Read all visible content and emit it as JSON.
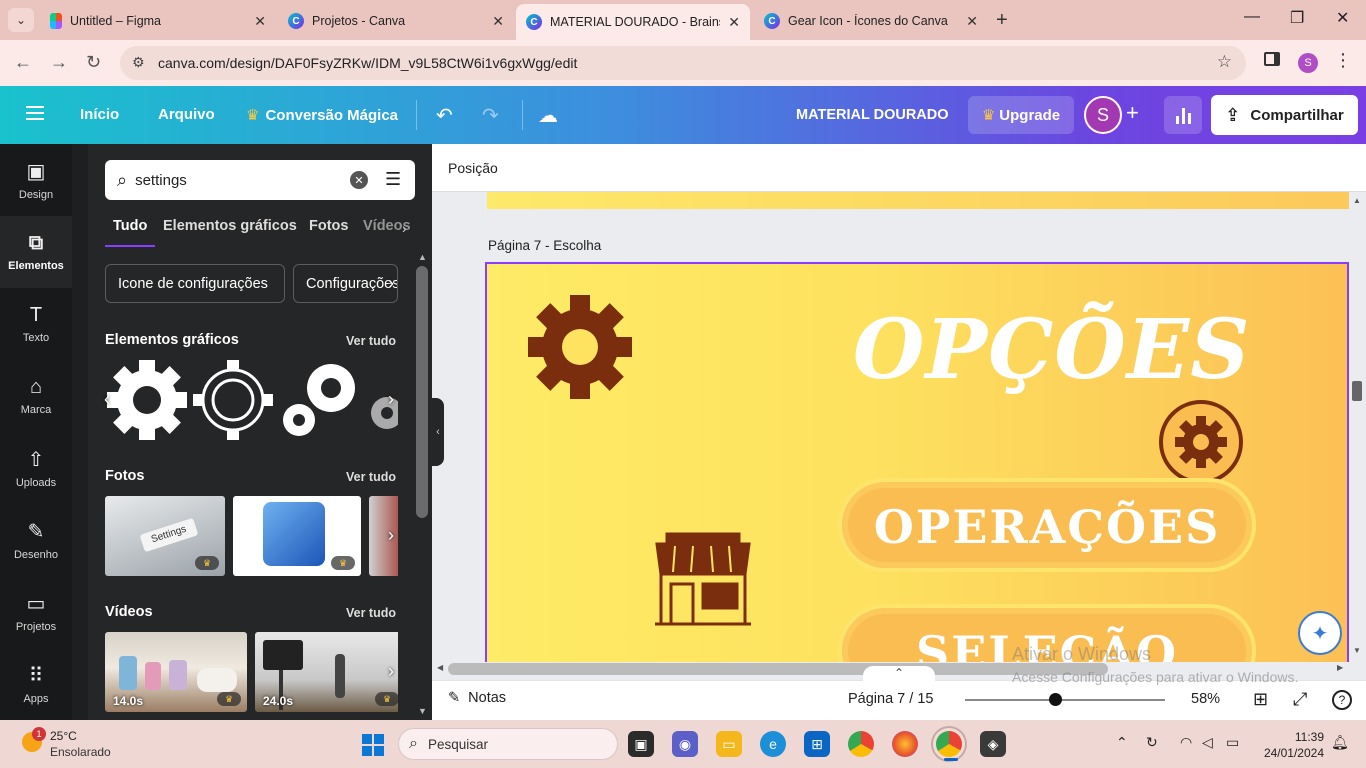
{
  "browser": {
    "tabs": [
      {
        "title": "Untitled – Figma",
        "favicon": "figma-icon"
      },
      {
        "title": "Projetos - Canva",
        "favicon": "canva-icon"
      },
      {
        "title": "MATERIAL DOURADO - Brainsto",
        "favicon": "canva-icon",
        "active": true
      },
      {
        "title": "Gear Icon - Ícones do Canva",
        "favicon": "canva-icon"
      }
    ],
    "url": "canva.com/design/DAF0FsyZRKw/IDM_v9L58CtW6i1v6gxWgg/edit",
    "profile_initial": "S"
  },
  "header": {
    "inicio": "Início",
    "arquivo": "Arquivo",
    "magic": "Conversão Mágica",
    "doc_title": "MATERIAL DOURADO",
    "upgrade": "Upgrade",
    "avatar_initial": "S",
    "share": "Compartilhar",
    "gradient_start": "#19c2cd",
    "gradient_end": "#7a3fe4"
  },
  "rail": [
    {
      "label": "Design",
      "icon": "layout-icon"
    },
    {
      "label": "Elementos",
      "icon": "shapes-icon",
      "active": true
    },
    {
      "label": "Texto",
      "icon": "text-icon"
    },
    {
      "label": "Marca",
      "icon": "brand-icon"
    },
    {
      "label": "Uploads",
      "icon": "upload-icon"
    },
    {
      "label": "Desenho",
      "icon": "draw-icon"
    },
    {
      "label": "Projetos",
      "icon": "folder-icon"
    },
    {
      "label": "Apps",
      "icon": "apps-icon"
    }
  ],
  "panel": {
    "search_value": "settings",
    "tabs": [
      "Tudo",
      "Elementos gráficos",
      "Fotos",
      "Vídeos"
    ],
    "chips": [
      "Icone de configurações",
      "Configurações"
    ],
    "graphics_title": "Elementos gráficos",
    "photos_title": "Fotos",
    "videos_title": "Vídeos",
    "see_all": "Ver tudo",
    "photo1_text": "Settings",
    "video_durations": [
      "14.0s",
      "24.0s"
    ]
  },
  "editor": {
    "context_label": "Posição",
    "page_label": "Página 7 - Escolha",
    "canvas_title": "OPÇÕES",
    "options": [
      "OPERAÇÕES",
      "SELEÇÃO"
    ],
    "accent_brown": "#7a2e0e",
    "selection_color": "#8b3dff"
  },
  "watermark": {
    "line1": "Ativar o Windows",
    "line2": "Acesse Configurações para ativar o Windows."
  },
  "bottombar": {
    "notes": "Notas",
    "page_count": "Página 7 / 15",
    "zoom": "58%",
    "zoom_fraction": 0.45
  },
  "taskbar": {
    "temp": "25°C",
    "weather": "Ensolarado",
    "weather_badge": "1",
    "search_placeholder": "Pesquisar",
    "time": "11:39",
    "date": "24/01/2024"
  }
}
